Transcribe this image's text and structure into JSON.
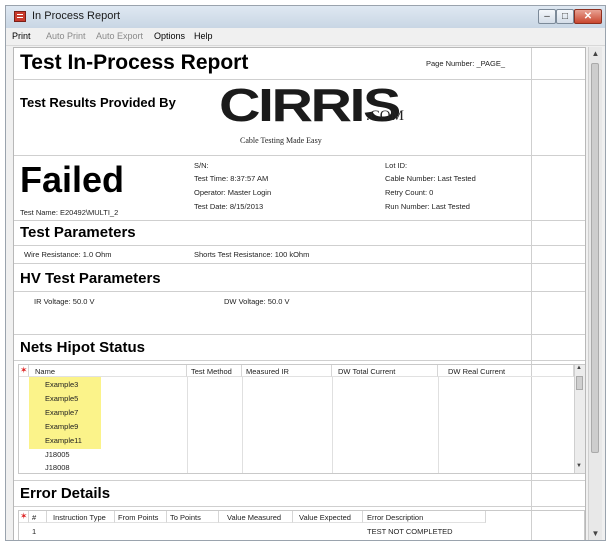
{
  "window": {
    "title": "In Process Report",
    "min_glyph": "–",
    "max_glyph": "□",
    "close_glyph": "✕"
  },
  "menu": [
    {
      "label": "Print",
      "enabled": true
    },
    {
      "label": "Auto Print",
      "enabled": false
    },
    {
      "label": "Auto Export",
      "enabled": false
    },
    {
      "label": "Options",
      "enabled": true
    },
    {
      "label": "Help",
      "enabled": true
    }
  ],
  "report": {
    "title": "Test In-Process Report",
    "page_number": "Page Number: _PAGE_",
    "provided_by": "Test Results Provided By",
    "logo": {
      "word": "CIRRIS",
      "suffix": ".COM",
      "tagline": "Cable Testing Made Easy"
    },
    "status": "Failed",
    "test_name": "Test Name: E20492\\MULTI_2",
    "sn": "S/N:",
    "test_time": "Test Time: 8:37:57 AM",
    "operator": "Operator: Master Login",
    "test_date": "Test Date: 8/15/2013",
    "lot_id": "Lot ID:",
    "cable_number": "Cable Number: Last Tested",
    "retry_count": "Retry Count: 0",
    "run_number": "Run Number: Last Tested",
    "test_parameters": {
      "heading": "Test Parameters",
      "wire_resistance": "Wire Resistance: 1.0 Ohm",
      "shorts_resistance": "Shorts Test Resistance: 100 kOhm"
    },
    "hv_parameters": {
      "heading": "HV Test Parameters",
      "ir_voltage": "IR Voltage: 50.0 V",
      "dw_voltage": "DW Voltage: 50.0 V"
    },
    "nets_hipot": {
      "heading": "Nets Hipot Status",
      "columns": [
        "Name",
        "Test Method",
        "Measured IR",
        "DW Total Current",
        "DW Real Current"
      ],
      "rows": [
        "Example3",
        "Example5",
        "Example7",
        "Example9",
        "Example11",
        "J18005",
        "J18008"
      ],
      "highlight_color": "#fbf38a"
    },
    "error_details": {
      "heading": "Error Details",
      "columns": [
        "#",
        "Instruction Type",
        "From Points",
        "To Points",
        "Value Measured",
        "Value Expected",
        "Error Description"
      ],
      "rows": [
        [
          "1",
          "",
          "",
          "",
          "",
          "",
          "TEST NOT COMPLETED"
        ]
      ]
    }
  }
}
